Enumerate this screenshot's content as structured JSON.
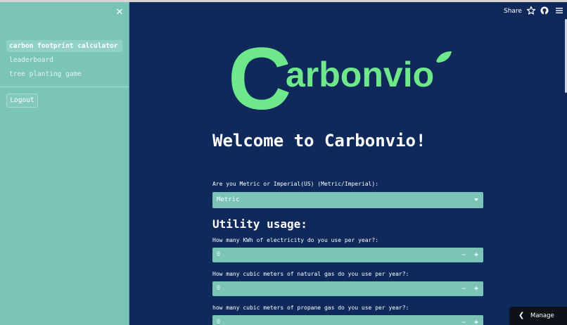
{
  "sidebar": {
    "close_icon": "close-icon",
    "items": [
      {
        "label": "carbon footprint calculator",
        "active": true
      },
      {
        "label": "leaderboard",
        "active": false
      },
      {
        "label": "tree planting game",
        "active": false
      }
    ],
    "logout_label": "Logout"
  },
  "header": {
    "share_label": "Share",
    "icons": [
      "star-icon",
      "github-icon",
      "menu-icon"
    ]
  },
  "logo": {
    "text": "arbonvio",
    "letter": "C",
    "color": "#6ee88a"
  },
  "main": {
    "welcome": "Welcome to Carbonvio!",
    "unit_question": "Are you Metric or Imperial(US) (Metric/Imperial):",
    "unit_selected": "Metric",
    "section_title": "Utility usage:",
    "questions": [
      {
        "label": "How many KWh of electricity do you use per year?:",
        "value": "0"
      },
      {
        "label": "How many cubic meters of natural gas do you use per year?:",
        "value": "0"
      },
      {
        "label": "how many cubic meters of propane gas do you use per year?:",
        "value": "0"
      }
    ],
    "minus": "−",
    "plus": "+"
  },
  "manage_app": {
    "label": "Manage app"
  },
  "colors": {
    "background": "#0f2a5a",
    "sidebar": "#7ac5b7",
    "accent": "#6ee88a"
  }
}
